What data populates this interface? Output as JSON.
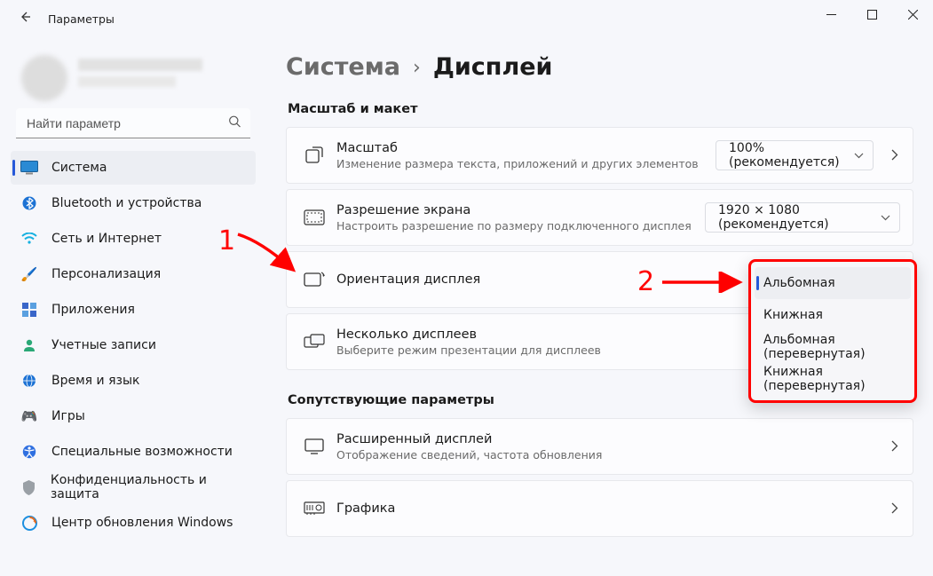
{
  "window": {
    "title": "Параметры"
  },
  "search": {
    "placeholder": "Найти параметр"
  },
  "sidebar": {
    "items": [
      {
        "label": "Система",
        "icon": "🖥️",
        "active": true
      },
      {
        "label": "Bluetooth и устройства",
        "icon": "bt"
      },
      {
        "label": "Сеть и Интернет",
        "icon": "wifi"
      },
      {
        "label": "Персонализация",
        "icon": "🖌️"
      },
      {
        "label": "Приложения",
        "icon": "apps"
      },
      {
        "label": "Учетные записи",
        "icon": "👤"
      },
      {
        "label": "Время и язык",
        "icon": "🌐"
      },
      {
        "label": "Игры",
        "icon": "🎮"
      },
      {
        "label": "Специальные возможности",
        "icon": "acc"
      },
      {
        "label": "Конфиденциальность и защита",
        "icon": "🛡️"
      },
      {
        "label": "Центр обновления Windows",
        "icon": "upd"
      }
    ]
  },
  "breadcrumb": {
    "parent": "Система",
    "current": "Дисплей"
  },
  "sections": {
    "scale": "Масштаб и макет",
    "related": "Сопутствующие параметры"
  },
  "cards": {
    "scale": {
      "title": "Масштаб",
      "sub": "Изменение размера текста, приложений и других элементов",
      "value": "100% (рекомендуется)"
    },
    "resolution": {
      "title": "Разрешение экрана",
      "sub": "Настроить разрешение по размеру подключенного дисплея",
      "value": "1920 × 1080 (рекомендуется)"
    },
    "orientation": {
      "title": "Ориентация дисплея"
    },
    "multi": {
      "title": "Несколько дисплеев",
      "sub": "Выберите режим презентации для дисплеев"
    },
    "advanced": {
      "title": "Расширенный дисплей",
      "sub": "Отображение сведений, частота обновления"
    },
    "graphics": {
      "title": "Графика"
    }
  },
  "orientation_options": [
    "Альбомная",
    "Книжная",
    "Альбомная (перевернутая)",
    "Книжная (перевернутая)"
  ],
  "annotations": {
    "one": "1",
    "two": "2"
  },
  "colors": {
    "accent": "#2658d8",
    "annotation": "#ff0000"
  }
}
